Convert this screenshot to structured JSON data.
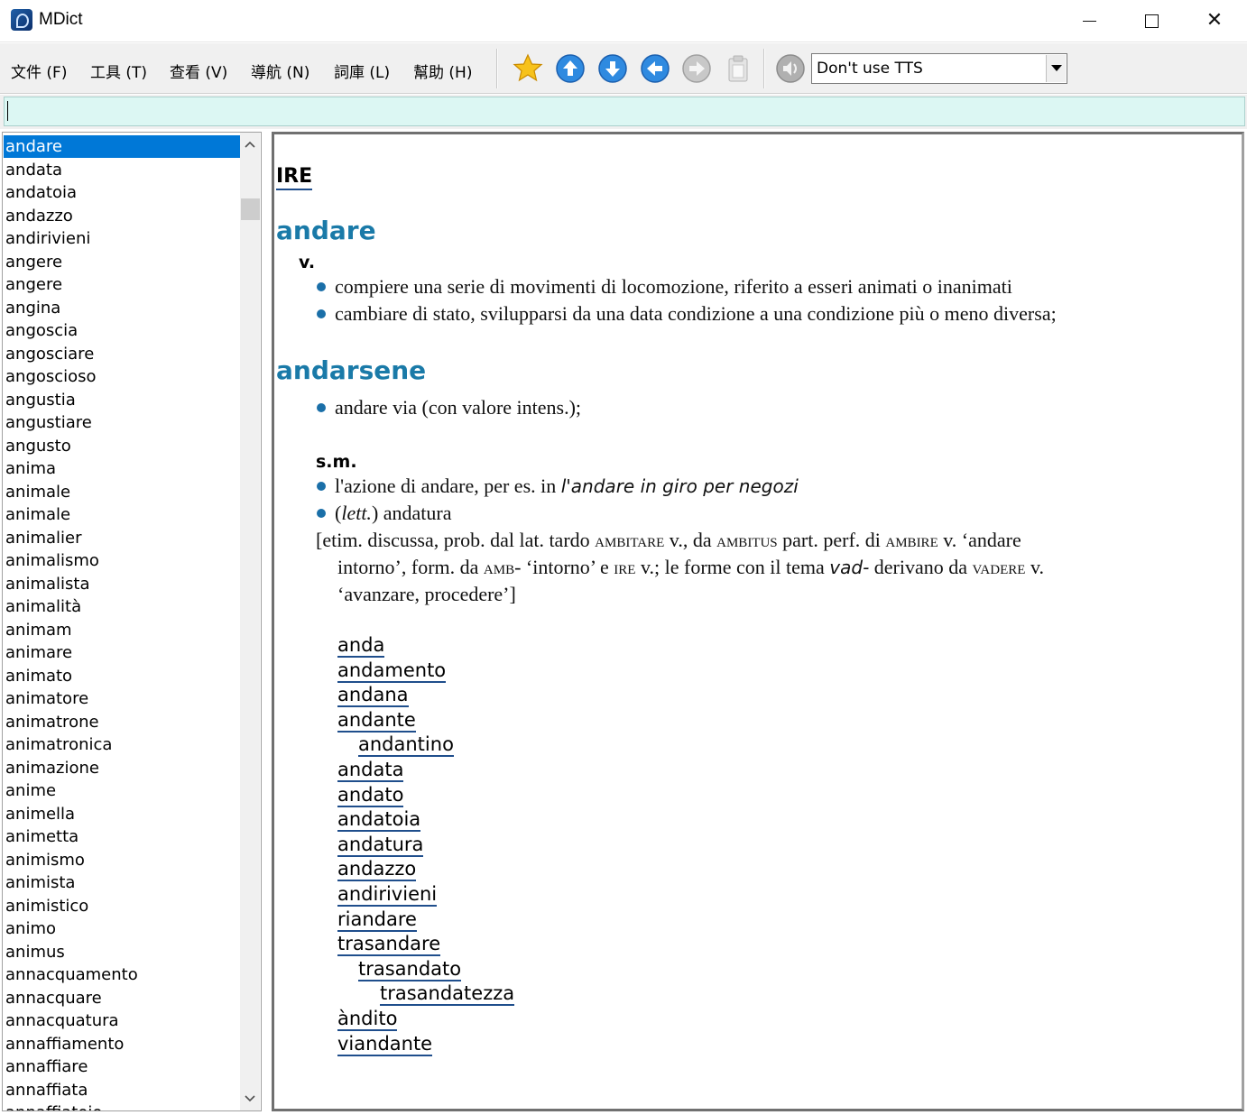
{
  "window": {
    "title": "MDict"
  },
  "menu": [
    "文件 (F)",
    "工具 (T)",
    "查看 (V)",
    "導航 (N)",
    "詞庫 (L)",
    "幫助 (H)"
  ],
  "toolbar": {
    "icons": [
      "favorite-star-icon",
      "arrow-up-icon",
      "arrow-down-icon",
      "arrow-back-icon",
      "arrow-forward-icon",
      "clipboard-icon",
      "speaker-icon"
    ],
    "tts_value": "Don't use TTS"
  },
  "search": {
    "value": ""
  },
  "wordlist": {
    "selected": "andare",
    "items": [
      "andare",
      "andata",
      "andatoia",
      "andazzo",
      "andirivieni",
      "angere",
      "angere",
      "angina",
      "angoscia",
      "angosciare",
      "angoscioso",
      "angustia",
      "angustiare",
      "angusto",
      "anima",
      "animale",
      "animale",
      "animalier",
      "animalismo",
      "animalista",
      "animalità",
      "animam",
      "animare",
      "animato",
      "animatore",
      "animatrone",
      "animatronica",
      "animazione",
      "anime",
      "animella",
      "animetta",
      "animismo",
      "animista",
      "animistico",
      "animo",
      "animus",
      "annacquamento",
      "annacquare",
      "annacquatura",
      "annaffiamento",
      "annaffiare",
      "annaffiata",
      "annaffiatoio"
    ]
  },
  "entry": {
    "root": "IRE",
    "headword1": "andare",
    "pos1": "v.",
    "def1": "compiere una serie di movimenti di locomozione, riferito a esseri animati o inanimati",
    "def2": "cambiare di stato, svilupparsi da una data condizione a una condizione più o meno diversa;",
    "headword2": "andarsene",
    "def3": "andare via (con valore intens.);",
    "pos2": "s.m.",
    "def4_a": "l'azione di andare, per es. in ",
    "def4_b": "l'andare in giro per negozi",
    "def5_a": "(",
    "def5_b": "lett.",
    "def5_c": ") andatura",
    "etym1_a": "[etim. discussa, prob. dal lat. tardo ",
    "etym1_b": "ambitare",
    "etym1_c": " v., da ",
    "etym1_d": "ambitus",
    "etym1_e": " part. perf. di ",
    "etym1_f": "ambire",
    "etym1_g": " v. ‘andare",
    "etym2_a": "intorno’, form. da ",
    "etym2_b": "amb-",
    "etym2_c": " ‘intorno’ e ",
    "etym2_d": "ire",
    "etym2_e": " v.; le forme con il tema ",
    "etym2_f": "vad-",
    "etym2_g": " derivano da ",
    "etym2_h": "vadere",
    "etym2_i": " v.",
    "etym3": "‘avanzare, procedere’]",
    "related": [
      {
        "word": "anda",
        "level": 0
      },
      {
        "word": "andamento",
        "level": 0
      },
      {
        "word": "andana",
        "level": 0
      },
      {
        "word": "andante",
        "level": 0
      },
      {
        "word": "andantino",
        "level": 1
      },
      {
        "word": "andata",
        "level": 0
      },
      {
        "word": "andato",
        "level": 0
      },
      {
        "word": "andatoia",
        "level": 0
      },
      {
        "word": "andatura",
        "level": 0
      },
      {
        "word": "andazzo",
        "level": 0
      },
      {
        "word": "andirivieni",
        "level": 0
      },
      {
        "word": "riandare",
        "level": 0
      },
      {
        "word": "trasandare",
        "level": 0
      },
      {
        "word": "trasandato",
        "level": 1
      },
      {
        "word": "trasandatezza",
        "level": 2
      },
      {
        "word": "àndito",
        "level": 0
      },
      {
        "word": "viandante",
        "level": 0
      }
    ]
  }
}
